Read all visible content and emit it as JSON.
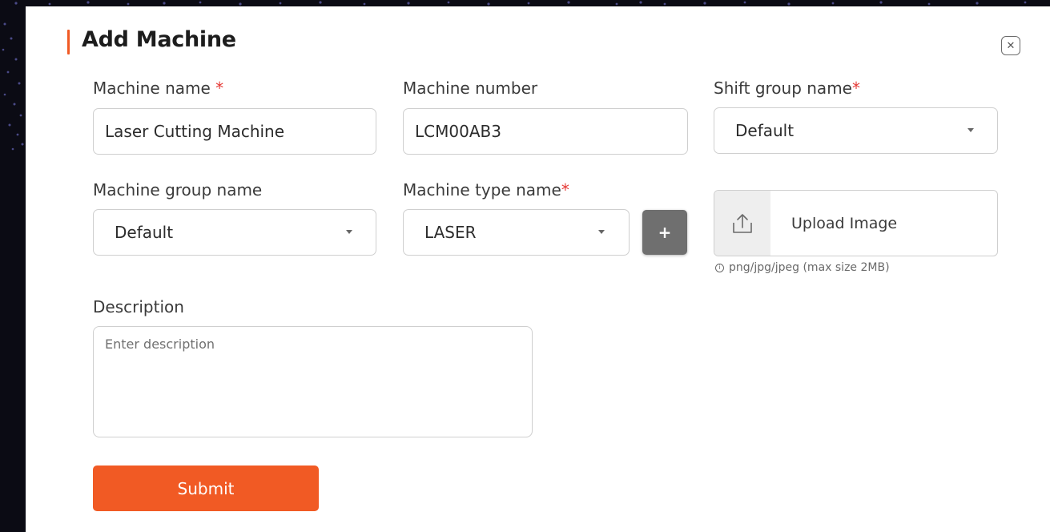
{
  "dialog": {
    "title": "Add Machine",
    "accent_color": "#f15a24",
    "close_icon": "close-icon"
  },
  "fields": {
    "machine_name": {
      "label": "Machine name",
      "required_mark": "*",
      "value": "Laser Cutting Machine"
    },
    "machine_number": {
      "label": "Machine number",
      "value": "LCM00AB3"
    },
    "shift_group": {
      "label": "Shift group name",
      "required_mark": "*",
      "value": "Default"
    },
    "machine_group": {
      "label": "Machine group name",
      "value": "Default"
    },
    "machine_type": {
      "label": "Machine type name",
      "required_mark": "*",
      "value": "LASER",
      "add_label": "+"
    },
    "upload": {
      "label": "Upload Image",
      "icon": "upload-icon",
      "hint": "png/jpg/jpeg (max size 2MB)",
      "hint_icon": "info-icon"
    },
    "description": {
      "label": "Description",
      "placeholder": "Enter description"
    }
  },
  "actions": {
    "submit_label": "Submit"
  }
}
